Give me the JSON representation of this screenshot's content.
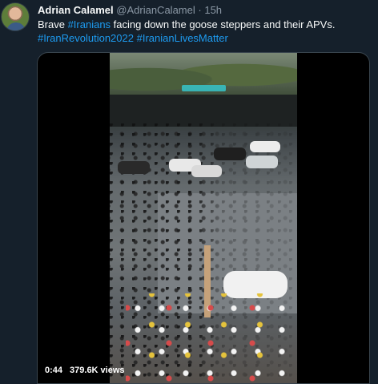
{
  "tweet": {
    "author_name": "Adrian Calamel",
    "handle": "@AdrianCalamel",
    "separator": "·",
    "time": "15h",
    "text_prefix": "Brave ",
    "hashtag_1": "#Iranians",
    "text_middle": " facing down the goose steppers and their APVs.",
    "hashtag_2": "#IranRevolution2022",
    "hashtag_3": "#IranianLivesMatter"
  },
  "video": {
    "duration": "0:44",
    "views": "379.6K views"
  },
  "colors": {
    "background": "#15202b",
    "link": "#1d9bf0",
    "muted": "#8b98a5",
    "text": "#f7f9f9"
  }
}
